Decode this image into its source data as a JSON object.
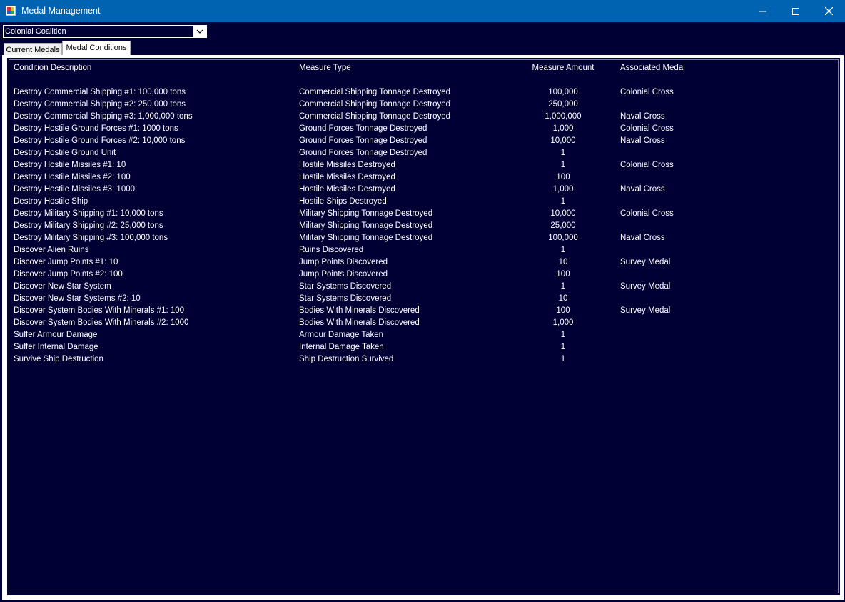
{
  "window": {
    "title": "Medal Management"
  },
  "race_selector": {
    "value": "Colonial Coalition"
  },
  "tabs": [
    {
      "label": "Current Medals",
      "active": false
    },
    {
      "label": "Medal Conditions",
      "active": true
    }
  ],
  "table": {
    "headers": [
      "Condition Description",
      "Measure Type",
      "Measure Amount",
      "Associated Medal"
    ],
    "rows": [
      [
        "Destroy Commercial Shipping #1:  100,000 tons",
        "Commercial Shipping Tonnage Destroyed",
        "100,000",
        "Colonial Cross"
      ],
      [
        "Destroy Commercial Shipping #2:  250,000 tons",
        "Commercial Shipping Tonnage Destroyed",
        "250,000",
        ""
      ],
      [
        "Destroy Commercial Shipping #3:  1,000,000 tons",
        "Commercial Shipping Tonnage Destroyed",
        "1,000,000",
        "Naval Cross"
      ],
      [
        "Destroy Hostile Ground Forces #1:  1000 tons",
        "Ground Forces Tonnage Destroyed",
        "1,000",
        "Colonial Cross"
      ],
      [
        "Destroy Hostile Ground Forces #2:  10,000 tons",
        "Ground Forces Tonnage Destroyed",
        "10,000",
        "Naval Cross"
      ],
      [
        "Destroy Hostile Ground Unit",
        "Ground Forces Tonnage Destroyed",
        "1",
        ""
      ],
      [
        "Destroy Hostile Missiles #1:  10",
        "Hostile Missiles Destroyed",
        "1",
        "Colonial Cross"
      ],
      [
        "Destroy Hostile Missiles #2:  100",
        "Hostile Missiles Destroyed",
        "100",
        ""
      ],
      [
        "Destroy Hostile Missiles #3: 1000",
        "Hostile Missiles Destroyed",
        "1,000",
        "Naval Cross"
      ],
      [
        "Destroy Hostile Ship",
        "Hostile Ships Destroyed",
        "1",
        ""
      ],
      [
        "Destroy Military Shipping #1:  10,000 tons",
        "Military Shipping Tonnage Destroyed",
        "10,000",
        "Colonial Cross"
      ],
      [
        "Destroy Military Shipping #2:  25,000 tons",
        "Military Shipping Tonnage Destroyed",
        "25,000",
        ""
      ],
      [
        "Destroy Military Shipping #3:  100,000 tons",
        "Military Shipping Tonnage Destroyed",
        "100,000",
        "Naval Cross"
      ],
      [
        "Discover Alien Ruins",
        "Ruins Discovered",
        "1",
        ""
      ],
      [
        "Discover Jump Points #1:  10",
        "Jump Points Discovered",
        "10",
        "Survey Medal"
      ],
      [
        "Discover Jump Points #2:  100",
        "Jump Points Discovered",
        "100",
        ""
      ],
      [
        "Discover New Star System",
        "Star Systems Discovered",
        "1",
        "Survey Medal"
      ],
      [
        "Discover New Star Systems #2: 10",
        "Star Systems Discovered",
        "10",
        ""
      ],
      [
        "Discover System Bodies With Minerals #1:  100",
        "Bodies With Minerals Discovered",
        "100",
        "Survey Medal"
      ],
      [
        "Discover System Bodies With Minerals #2:  1000",
        "Bodies With Minerals Discovered",
        "1,000",
        ""
      ],
      [
        "Suffer Armour Damage",
        "Armour Damage Taken",
        "1",
        ""
      ],
      [
        "Suffer Internal Damage",
        "Internal Damage Taken",
        "1",
        ""
      ],
      [
        "Survive Ship Destruction",
        "Ship Destruction Survived",
        "1",
        ""
      ]
    ]
  },
  "icons": {
    "app": "medal-management-app-icon",
    "minimize": "minimize-icon",
    "maximize": "maximize-icon",
    "close": "close-icon",
    "dropdown": "chevron-down-icon"
  },
  "colors": {
    "titlebar": "#0063b1",
    "background": "#000035",
    "text": "#ffffff"
  }
}
